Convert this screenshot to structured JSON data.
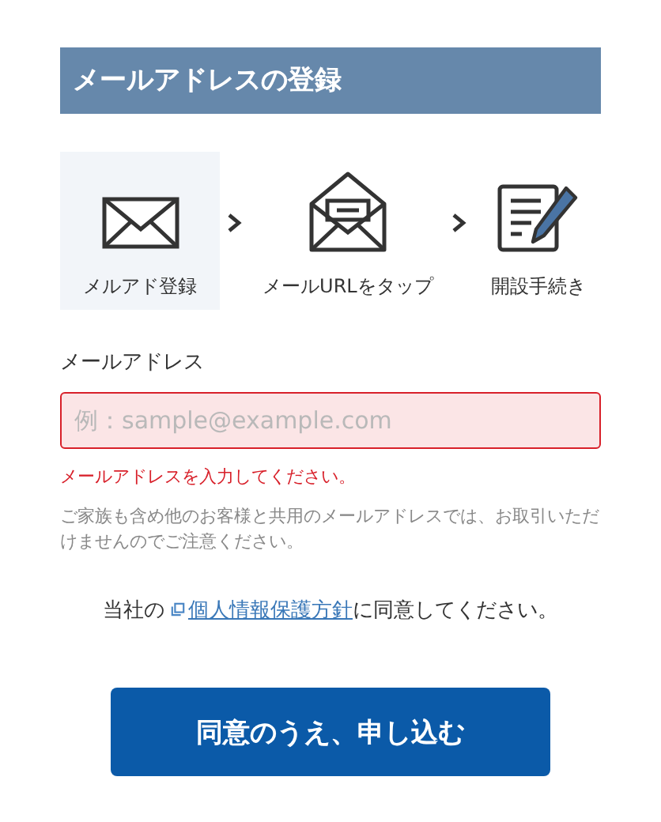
{
  "title": "メールアドレスの登録",
  "steps": [
    {
      "kind": "envelope",
      "label": "メルアド登録",
      "selected": true
    },
    {
      "kind": "open-envelope",
      "label": "メールURLをタップ",
      "selected": false
    },
    {
      "kind": "form",
      "label": "開設手続き",
      "selected": false
    }
  ],
  "email_field": {
    "label": "メールアドレス",
    "placeholder": "例：sample@example.com",
    "error": true,
    "error_message": "メールアドレスを入力してください。"
  },
  "note": "ご家族も含め他のお客様と共用のメールアドレスでは、お取引いただけませんのでご注意ください。",
  "consent": {
    "before": "当社の",
    "link": "個人情報保護方針",
    "after": "に同意してください。"
  },
  "submit_button": "同意のうえ、申し込む"
}
